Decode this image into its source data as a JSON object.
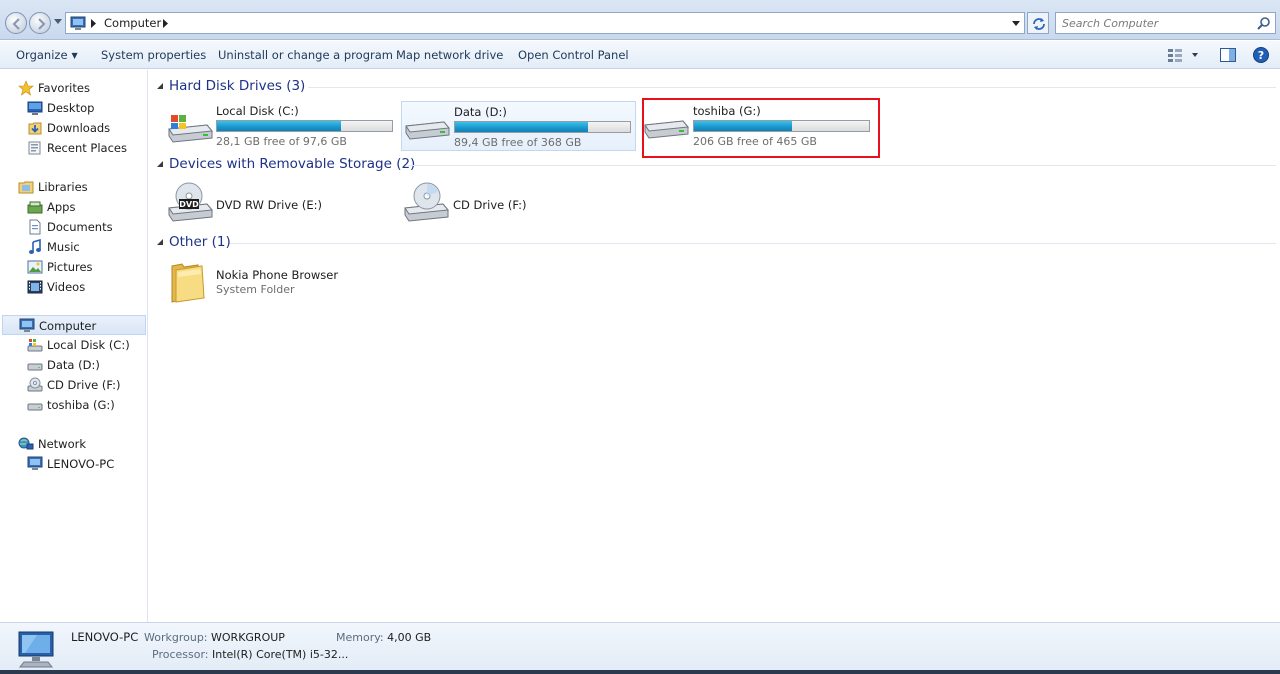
{
  "address": {
    "crumb": "Computer",
    "search_placeholder": "Search Computer"
  },
  "toolbar": {
    "organize": "Organize",
    "system_properties": "System properties",
    "uninstall": "Uninstall or change a program",
    "map_drive": "Map network drive",
    "control_panel": "Open Control Panel"
  },
  "nav": {
    "favorites": "Favorites",
    "desktop": "Desktop",
    "downloads": "Downloads",
    "recent": "Recent Places",
    "libraries": "Libraries",
    "apps": "Apps",
    "documents": "Documents",
    "music": "Music",
    "pictures": "Pictures",
    "videos": "Videos",
    "computer": "Computer",
    "local_c": "Local Disk (C:)",
    "data_d": "Data (D:)",
    "cd_f": "CD Drive (F:)",
    "toshiba_g": "toshiba (G:)",
    "network": "Network",
    "lenovo": "LENOVO-PC"
  },
  "groups": {
    "hdd": "Hard Disk Drives (3)",
    "removable": "Devices with Removable Storage (2)",
    "other": "Other (1)"
  },
  "drives": [
    {
      "name": "Local Disk (C:)",
      "free": "28,1 GB free of 97,6 GB",
      "used_fraction": 0.71
    },
    {
      "name": "Data (D:)",
      "free": "89,4 GB free of 368 GB",
      "used_fraction": 0.76
    },
    {
      "name": "toshiba (G:)",
      "free": "206 GB free of 465 GB",
      "used_fraction": 0.56
    }
  ],
  "devices": [
    {
      "name": "DVD RW Drive (E:)",
      "badge": "DVD"
    },
    {
      "name": "CD Drive (F:)"
    }
  ],
  "other_items": [
    {
      "name": "Nokia Phone Browser",
      "sub": "System Folder"
    }
  ],
  "details": {
    "pc_name": "LENOVO-PC",
    "workgroup_label": "Workgroup:",
    "workgroup": "WORKGROUP",
    "memory_label": "Memory:",
    "memory": "4,00 GB",
    "processor_label": "Processor:",
    "processor": "Intel(R) Core(TM) i5-32..."
  }
}
